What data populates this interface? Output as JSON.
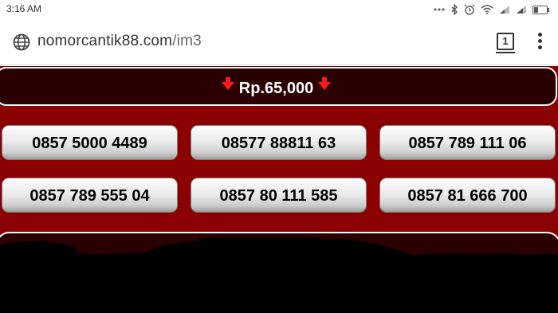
{
  "status_bar": {
    "time": "3:16 AM",
    "icons": [
      "signal-dots-icon",
      "bluetooth-icon",
      "alarm-icon",
      "wifi-icon",
      "signal-icon",
      "signal-icon",
      "battery-icon"
    ]
  },
  "browser": {
    "domain": "nomorcantik88.com",
    "path": "/im3",
    "tab_count": "1",
    "icons": [
      "globe-icon",
      "tabs-icon",
      "menu-icon"
    ]
  },
  "page": {
    "price": "Rp.65,000",
    "numbers": [
      "0857 5000 4489",
      "08577 88811 63",
      "0857 789 111 06",
      "0857 789 555 04",
      "0857 80 111 585",
      "0857 81 666 700"
    ],
    "colors": {
      "background": "#8b0000",
      "price_bar": "#2b0000",
      "arrow": "#ff1a1a"
    }
  }
}
